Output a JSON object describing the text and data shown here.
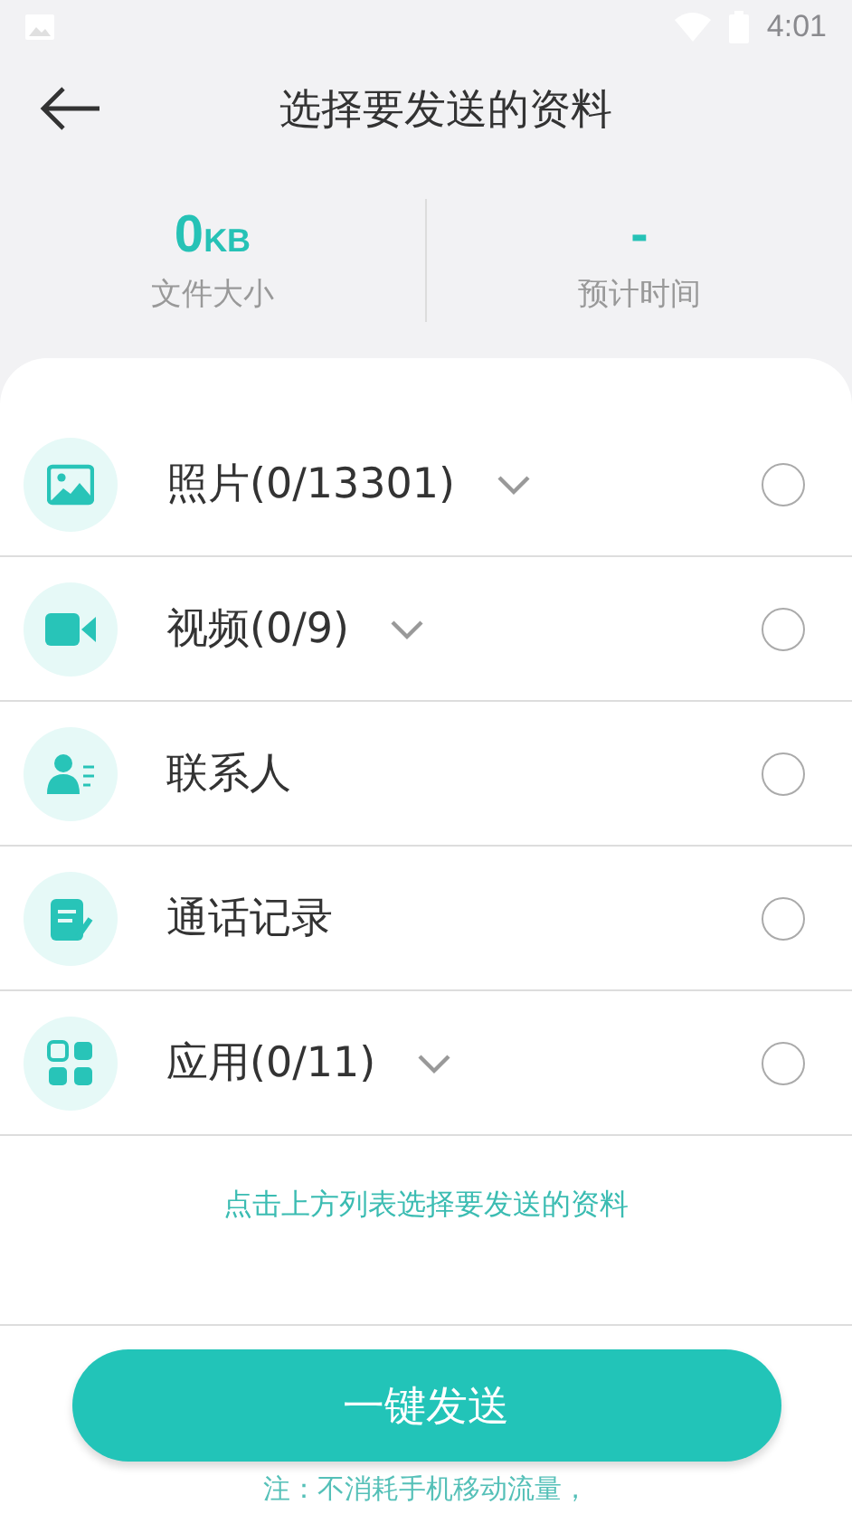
{
  "status_bar": {
    "time": "4:01"
  },
  "header": {
    "title": "选择要发送的资料"
  },
  "stats": [
    {
      "value": "0",
      "unit": "KB",
      "label": "文件大小"
    },
    {
      "value": "-",
      "label": "预计时间"
    }
  ],
  "items": [
    {
      "kind": "photo",
      "label": "照片(0/13301)",
      "expandable": true,
      "checked": false
    },
    {
      "kind": "video",
      "label": "视频(0/9)",
      "expandable": true,
      "checked": false
    },
    {
      "kind": "contact",
      "label": "联系人",
      "expandable": false,
      "checked": false
    },
    {
      "kind": "call-log",
      "label": "通话记录",
      "expandable": false,
      "checked": false
    },
    {
      "kind": "apps",
      "label": "应用(0/11)",
      "expandable": true,
      "checked": false
    }
  ],
  "hint": "点击上方列表选择要发送的资料",
  "send_button": "一键发送",
  "note": "注：不消耗手机移动流量，"
}
